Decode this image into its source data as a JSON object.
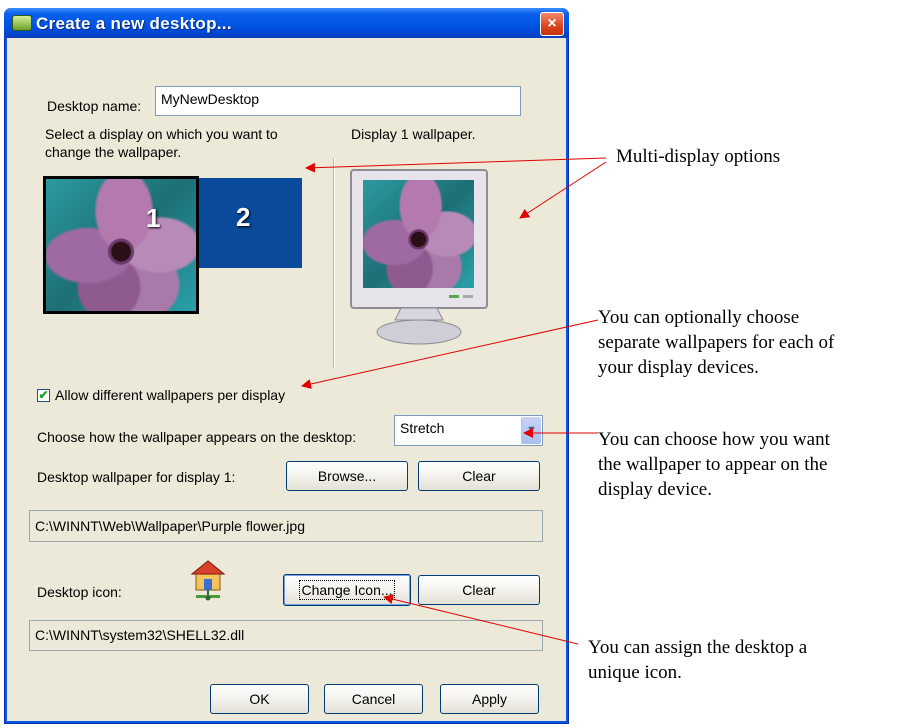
{
  "dialog": {
    "title": "Create a new desktop...",
    "close_glyph": "×",
    "desktop_name_label": "Desktop name:",
    "desktop_name_value": "MyNewDesktop",
    "select_display_text_1": "Select a display on which you want to",
    "select_display_text_2": "change the wallpaper.",
    "display_wallpaper_label": "Display 1 wallpaper.",
    "display1_number": "1",
    "display2_number": "2",
    "allow_different_label": "Allow different wallpapers per display",
    "allow_different_checked": true,
    "checkmark": "✔",
    "wallpaper_mode_label": "Choose how the wallpaper appears on the desktop:",
    "wallpaper_mode_value": "Stretch",
    "dropdown_arrow": "▼",
    "wallpaper_display_label": "Desktop wallpaper for display 1:",
    "browse_label": "Browse...",
    "clear_label": "Clear",
    "wallpaper_path": "C:\\WINNT\\Web\\Wallpaper\\Purple flower.jpg",
    "desktop_icon_label": "Desktop icon:",
    "change_icon_label": "Change Icon...",
    "clear_icon_label": "Clear",
    "icon_path": "C:\\WINNT\\system32\\SHELL32.dll",
    "ok_label": "OK",
    "cancel_label": "Cancel",
    "apply_label": "Apply"
  },
  "annotations": {
    "multi_display": "Multi-display options",
    "separate_wallpapers_1": "You can optionally choose",
    "separate_wallpapers_2": "separate wallpapers for each of",
    "separate_wallpapers_3": "your display devices.",
    "wallpaper_appear_1": "You can choose how you want",
    "wallpaper_appear_2": "the wallpaper to appear on the",
    "wallpaper_appear_3": "display device.",
    "assign_icon_1": "You can assign the desktop a",
    "assign_icon_2": "unique icon."
  },
  "colors": {
    "titlebar": "#0055e5",
    "client_bg": "#ece9d8",
    "display2_bg": "#0a4a9a",
    "arrow": "#e00000"
  }
}
